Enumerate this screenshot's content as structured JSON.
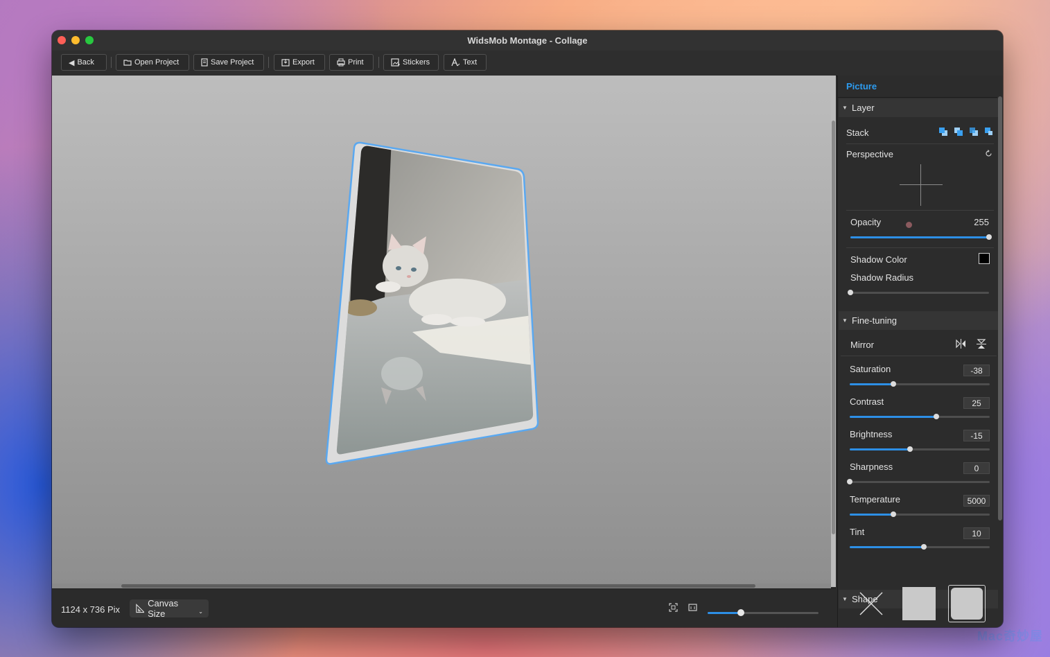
{
  "window": {
    "title": "WidsMob Montage - Collage"
  },
  "toolbar": {
    "back": "Back",
    "open_project": "Open Project",
    "save_project": "Save Project",
    "export": "Export",
    "print": "Print",
    "stickers": "Stickers",
    "text": "Text"
  },
  "status": {
    "canvas_dimensions": "1124 x 736 Pix",
    "canvas_size_label": "Canvas Size",
    "zoom_fraction": 0.3
  },
  "panel": {
    "title": "Picture",
    "layer_section": "Layer",
    "stack_label": "Stack",
    "perspective_label": "Perspective",
    "opacity_label": "Opacity",
    "opacity_value": "255",
    "opacity_fraction": 1.0,
    "shadow_color_label": "Shadow Color",
    "shadow_color": "#000000",
    "shadow_radius_label": "Shadow Radius",
    "shadow_radius_fraction": 0.0,
    "finetuning_section": "Fine-tuning",
    "mirror_label": "Mirror",
    "adjustments": [
      {
        "label": "Saturation",
        "value": "-38",
        "fraction": 0.31
      },
      {
        "label": "Contrast",
        "value": "25",
        "fraction": 0.62
      },
      {
        "label": "Brightness",
        "value": "-15",
        "fraction": 0.43
      },
      {
        "label": "Sharpness",
        "value": "0",
        "fraction": 0.0
      },
      {
        "label": "Temperature",
        "value": "5000",
        "fraction": 0.31
      },
      {
        "label": "Tint",
        "value": "10",
        "fraction": 0.53
      }
    ],
    "shape_section": "Shape"
  },
  "colors": {
    "accent": "#2d8fe6",
    "panel_title": "#2d9cf0",
    "frame_border": "#5aa8f0"
  },
  "watermark": "Mac奇妙屋"
}
